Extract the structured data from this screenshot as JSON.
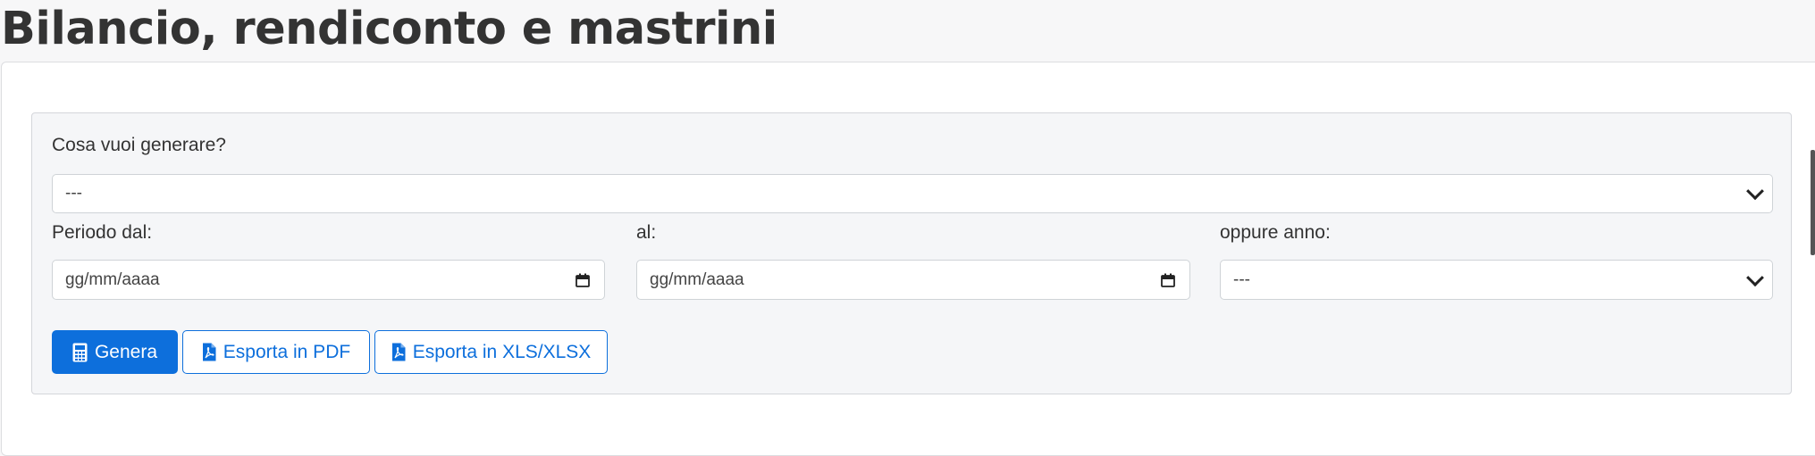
{
  "page": {
    "title": "Bilancio, rendiconto e mastrini"
  },
  "form": {
    "type_label": "Cosa vuoi generare?",
    "type_value": "---",
    "from_label": "Periodo dal:",
    "from_placeholder": "gg/mm/aaaa",
    "to_label": "al:",
    "to_placeholder": "gg/mm/aaaa",
    "year_label": "oppure anno:",
    "year_value": "---"
  },
  "actions": {
    "generate": "Genera",
    "export_pdf": "Esporta in PDF",
    "export_xls": "Esporta in XLS/XLSX"
  },
  "icons": {
    "generate": "calculator-icon",
    "export_pdf": "file-pdf-icon",
    "export_xls": "file-pdf-icon",
    "select": "chevron-down-icon",
    "date": "calendar-icon"
  },
  "colors": {
    "primary": "#0d6fdc",
    "title": "#333333",
    "panel": "#f5f6f8"
  }
}
